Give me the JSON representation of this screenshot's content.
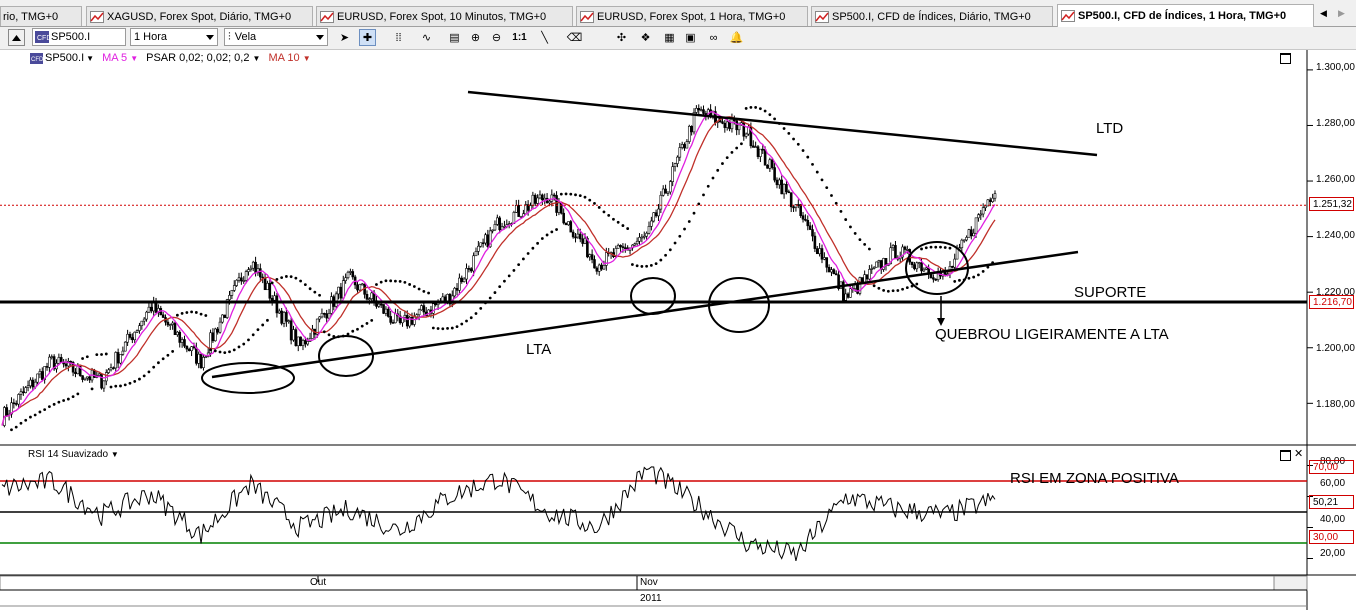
{
  "tabs": [
    {
      "label": "rio, TMG+0",
      "active": false
    },
    {
      "label": "XAGUSD, Forex Spot, Diário, TMG+0",
      "active": false
    },
    {
      "label": "EURUSD, Forex Spot, 10 Minutos, TMG+0",
      "active": false
    },
    {
      "label": "EURUSD, Forex Spot, 1 Hora, TMG+0",
      "active": false
    },
    {
      "label": "SP500.I, CFD de Índices, Diário, TMG+0",
      "active": false
    },
    {
      "label": "SP500.I, CFD de Índices, 1 Hora, TMG+0",
      "active": true
    }
  ],
  "toolbar": {
    "symbol": "SP500.I",
    "timeframe": "1 Hora",
    "chart_type": "Vela",
    "zoom_label": "1:1"
  },
  "legend": {
    "symbol": "SP500.I",
    "ma5": "MA 5",
    "psar": "PSAR 0,02; 0,02; 0,2",
    "ma10": "MA 10",
    "rsi": "RSI 14 Suavizado"
  },
  "price_axis": [
    "1.300,00",
    "1.280,00",
    "1.260,00",
    "1.240,00",
    "1.220,00",
    "1.200,00",
    "1.180,00"
  ],
  "price_tags": {
    "last": "1.251,32",
    "support": "1.216,70"
  },
  "rsi_axis": [
    "80,00",
    "60,00",
    "40,00",
    "20,00"
  ],
  "rsi_tags": {
    "upper": "70,00",
    "current": "50,21",
    "lower": "30,00"
  },
  "time_axis": {
    "oct": "Out",
    "nov": "Nov",
    "year": "2011"
  },
  "annotations": {
    "ltd": "LTD",
    "suporte": "SUPORTE",
    "lta": "LTA",
    "quebrou": "QUEBROU LIGEIRAMENTE A LTA",
    "rsi_note": "RSI EM ZONA POSITIVA"
  },
  "colors": {
    "ma5": "#e020e0",
    "ma10": "#c0302a",
    "last_price_line": "#d00000",
    "rsi_upper": "#d00000",
    "rsi_lower": "#008000",
    "active_tab_icon": "#d02020"
  },
  "chart_data": {
    "type": "line",
    "series": [
      {
        "name": "SP500.I",
        "x": [
          0,
          10,
          20,
          30,
          40,
          50,
          60,
          70,
          80,
          90,
          100,
          110,
          120,
          130,
          140,
          150,
          160,
          170,
          180,
          190,
          200
        ],
        "values": [
          1175,
          1195,
          1188,
          1215,
          1195,
          1232,
          1200,
          1225,
          1208,
          1218,
          1245,
          1255,
          1230,
          1240,
          1285,
          1278,
          1250,
          1218,
          1235,
          1225,
          1258
        ]
      },
      {
        "name": "RSI 14 Suavizado",
        "values": [
          65,
          70,
          48,
          62,
          35,
          68,
          40,
          52,
          38,
          60,
          72,
          50,
          40,
          78,
          55,
          30,
          22,
          60,
          52,
          48,
          58
        ]
      }
    ],
    "ylim": [
      1165,
      1305
    ],
    "rsi_ylim": [
      10,
      90
    ]
  }
}
